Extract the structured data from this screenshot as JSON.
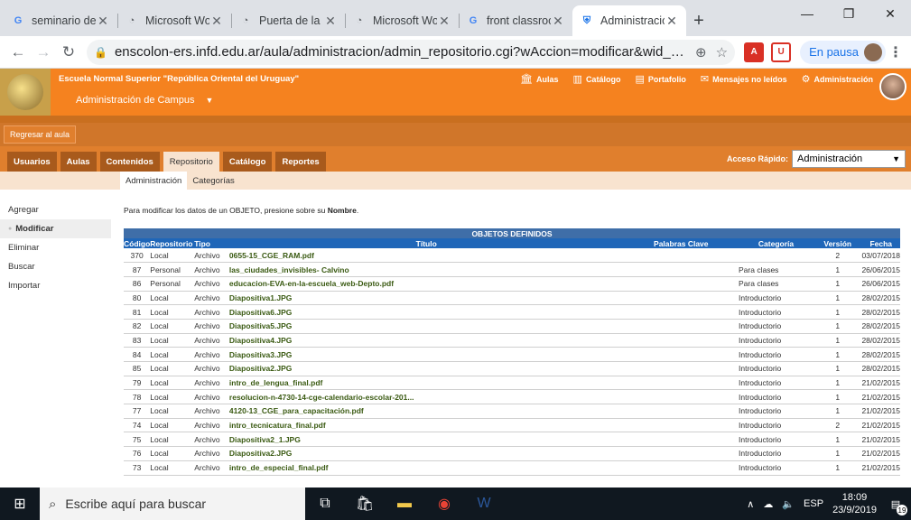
{
  "browser": {
    "tabs": [
      {
        "label": "seminario de e",
        "icon": "google-icon",
        "active": false
      },
      {
        "label": "Microsoft Word",
        "icon": "globe-icon",
        "active": false
      },
      {
        "label": "Puerta de la in",
        "icon": "globe-icon",
        "active": false
      },
      {
        "label": "Microsoft Word",
        "icon": "globe-icon",
        "active": false
      },
      {
        "label": "front classroom",
        "icon": "google-icon",
        "active": false
      },
      {
        "label": "Administración",
        "icon": "site-icon",
        "active": true
      }
    ],
    "url": "enscolon-ers.infd.edu.ar/aula/administracion/admin_repositorio.cgi?wAccion=modificar&wid_cursoActual...",
    "paused_label": "En pausa"
  },
  "site": {
    "school_name": "Escuela Normal Superior \"República Oriental del Uruguay\"",
    "campus_menu": "Administración de Campus",
    "top_nav": [
      "Aulas",
      "Catálogo",
      "Portafolio",
      "Mensajes no leídos",
      "Administración"
    ],
    "back_button": "Regresar al aula",
    "menu": [
      "Usuarios",
      "Aulas",
      "Contenidos",
      "Repositorio",
      "Catálogo",
      "Reportes"
    ],
    "active_menu": "Repositorio",
    "quick_access_label": "Acceso Rápido:",
    "quick_access_value": "Administración",
    "submenu": [
      "Administración",
      "Categorías"
    ]
  },
  "sidebar": {
    "items": [
      "Agregar",
      "Modificar",
      "Eliminar",
      "Buscar",
      "Importar"
    ],
    "selected": "Modificar"
  },
  "main": {
    "instruction_prefix": "Para modificar los datos de un OBJETO, presione sobre su ",
    "instruction_bold": "Nombre",
    "instruction_suffix": ".",
    "table_title": "OBJETOS DEFINIDOS",
    "columns": [
      "Código",
      "Repositorio",
      "Tipo",
      "Título",
      "Palabras Clave",
      "Categoría",
      "Versión",
      "Fecha"
    ],
    "rows": [
      [
        "370",
        "Local",
        "Archivo",
        "0655-15_CGE_RAM.pdf",
        "",
        "",
        "2",
        "03/07/2018"
      ],
      [
        "87",
        "Personal",
        "Archivo",
        "las_ciudades_invisibles- Calvino",
        "",
        "Para clases",
        "1",
        "26/06/2015"
      ],
      [
        "86",
        "Personal",
        "Archivo",
        "educacion-EVA-en-la-escuela_web-Depto.pdf",
        "",
        "Para clases",
        "1",
        "26/06/2015"
      ],
      [
        "80",
        "Local",
        "Archivo",
        "Diapositiva1.JPG",
        "",
        "Introductorio",
        "1",
        "28/02/2015"
      ],
      [
        "81",
        "Local",
        "Archivo",
        "Diapositiva6.JPG",
        "",
        "Introductorio",
        "1",
        "28/02/2015"
      ],
      [
        "82",
        "Local",
        "Archivo",
        "Diapositiva5.JPG",
        "",
        "Introductorio",
        "1",
        "28/02/2015"
      ],
      [
        "83",
        "Local",
        "Archivo",
        "Diapositiva4.JPG",
        "",
        "Introductorio",
        "1",
        "28/02/2015"
      ],
      [
        "84",
        "Local",
        "Archivo",
        "Diapositiva3.JPG",
        "",
        "Introductorio",
        "1",
        "28/02/2015"
      ],
      [
        "85",
        "Local",
        "Archivo",
        "Diapositiva2.JPG",
        "",
        "Introductorio",
        "1",
        "28/02/2015"
      ],
      [
        "79",
        "Local",
        "Archivo",
        "intro_de_lengua_final.pdf",
        "",
        "Introductorio",
        "1",
        "21/02/2015"
      ],
      [
        "78",
        "Local",
        "Archivo",
        "resolucion-n-4730-14-cge-calendario-escolar-201...",
        "",
        "Introductorio",
        "1",
        "21/02/2015"
      ],
      [
        "77",
        "Local",
        "Archivo",
        "4120-13_CGE_para_capacitación.pdf",
        "",
        "Introductorio",
        "1",
        "21/02/2015"
      ],
      [
        "74",
        "Local",
        "Archivo",
        "intro_tecnicatura_final.pdf",
        "",
        "Introductorio",
        "2",
        "21/02/2015"
      ],
      [
        "75",
        "Local",
        "Archivo",
        "Diapositiva2_1.JPG",
        "",
        "Introductorio",
        "1",
        "21/02/2015"
      ],
      [
        "76",
        "Local",
        "Archivo",
        "Diapositiva2.JPG",
        "",
        "Introductorio",
        "1",
        "21/02/2015"
      ],
      [
        "73",
        "Local",
        "Archivo",
        "intro_de_especial_final.pdf",
        "",
        "Introductorio",
        "1",
        "21/02/2015"
      ]
    ]
  },
  "taskbar": {
    "search_placeholder": "Escribe aquí para buscar",
    "language": "ESP",
    "time": "18:09",
    "date": "23/9/2019",
    "notifications": "19"
  },
  "colors": {
    "orange": "#f5821f",
    "table_header": "#1f66b8",
    "link_green": "#3a5a12"
  }
}
